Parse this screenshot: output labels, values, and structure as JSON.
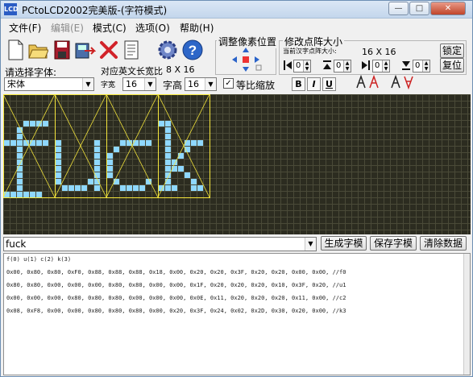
{
  "window": {
    "icon_text": "LCD",
    "title": "PCtoLCD2002完美版-(字符模式)",
    "caption_buttons": [
      "—",
      "□",
      "✕"
    ]
  },
  "menu": [
    {
      "label": "文件(F)",
      "enabled": true
    },
    {
      "label": "编辑(E)",
      "enabled": false
    },
    {
      "label": "模式(C)",
      "enabled": true
    },
    {
      "label": "选项(O)",
      "enabled": true
    },
    {
      "label": "帮助(H)",
      "enabled": true
    }
  ],
  "toolbar": {
    "icons": [
      "new-file-icon",
      "open-folder-icon",
      "save-icon",
      "generate-to-file-icon",
      "delete-icon",
      "document-icon",
      "settings-gear-icon",
      "help-icon"
    ],
    "help_glyph": "?"
  },
  "font_select": {
    "label": "请选择字体:",
    "value": "宋体",
    "ratio_label": "对应英文长宽比",
    "ratio_value": "8 X 16"
  },
  "size_row": {
    "width_label": "字宽",
    "width_value": "16",
    "height_label": "字高",
    "height_value": "16",
    "lock_label": "等比缩放",
    "lock_checked": true,
    "check_glyph": "✓",
    "bold": "B",
    "italic": "I",
    "underline": "U"
  },
  "pixel_group": {
    "title": "调整像素位置"
  },
  "dot_size_group": {
    "title": "修改点阵大小",
    "current_label": "当前汉字点阵大小:",
    "current_value": "16 X 16",
    "lock_button": "锁定",
    "restore_button": "复位",
    "spin_values": [
      "0",
      "0",
      "0",
      "0"
    ]
  },
  "dropdown_arrow": "▼",
  "spin_up": "▲",
  "spin_down": "▼",
  "input": {
    "value": "fuck",
    "placeholder": ""
  },
  "actions": {
    "generate": "生成字模",
    "save": "保存字模",
    "clear": "清除数据"
  },
  "preview": {
    "cell_size": 8,
    "pixel_color": "#8fd8ff",
    "grid_color": "#4a4a38",
    "guide_color": "#f5e63c",
    "glyphs": [
      {
        "char": "f",
        "rows": [
          "00000000",
          "00000000",
          "00000000",
          "00000000",
          "00011110",
          "00100000",
          "00100000",
          "11111110",
          "00100000",
          "00100000",
          "00100000",
          "00100000",
          "00100000",
          "00100000",
          "00100000",
          "11111100"
        ]
      },
      {
        "char": "u",
        "rows": [
          "00000000",
          "00000000",
          "00000000",
          "00000000",
          "00000000",
          "00000000",
          "00000000",
          "10000010",
          "10000010",
          "10000010",
          "10000010",
          "10000010",
          "10000010",
          "10000110",
          "01111010",
          "00000000"
        ]
      },
      {
        "char": "c",
        "rows": [
          "00000000",
          "00000000",
          "00000000",
          "00000000",
          "00000000",
          "00000000",
          "00000000",
          "00111110",
          "01000000",
          "10000000",
          "10000000",
          "10000000",
          "10000000",
          "01000010",
          "00111100",
          "00000000"
        ]
      },
      {
        "char": "k",
        "rows": [
          "00000000",
          "00000000",
          "00000000",
          "00000000",
          "11000000",
          "01000000",
          "01000000",
          "01001110",
          "01001000",
          "01010000",
          "01100000",
          "01110000",
          "01001000",
          "01000100",
          "11100110",
          "00000000"
        ]
      }
    ]
  },
  "output_lines": [
    " f(0) u(1) c(2) k(3)",
    "0x00, 0x80, 0x80, 0xF0, 0x88, 0x88, 0x88, 0x18, 0x00, 0x20, 0x20, 0x3F, 0x20, 0x20, 0x00, 0x00, //f0",
    "0x80, 0x80, 0x00, 0x00, 0x00, 0x80, 0x80, 0x00, 0x00, 0x1F, 0x20, 0x20, 0x20, 0x10, 0x3F, 0x20, //u1",
    "0x00, 0x00, 0x00, 0x80, 0x80, 0x80, 0x00, 0x00, 0x00, 0x0E, 0x11, 0x20, 0x20, 0x20, 0x11, 0x00, //c2",
    "0x08, 0xF8, 0x00, 0x00, 0x80, 0x80, 0x80, 0x00, 0x20, 0x3F, 0x24, 0x02, 0x2D, 0x30, 0x20, 0x00, //k3"
  ]
}
